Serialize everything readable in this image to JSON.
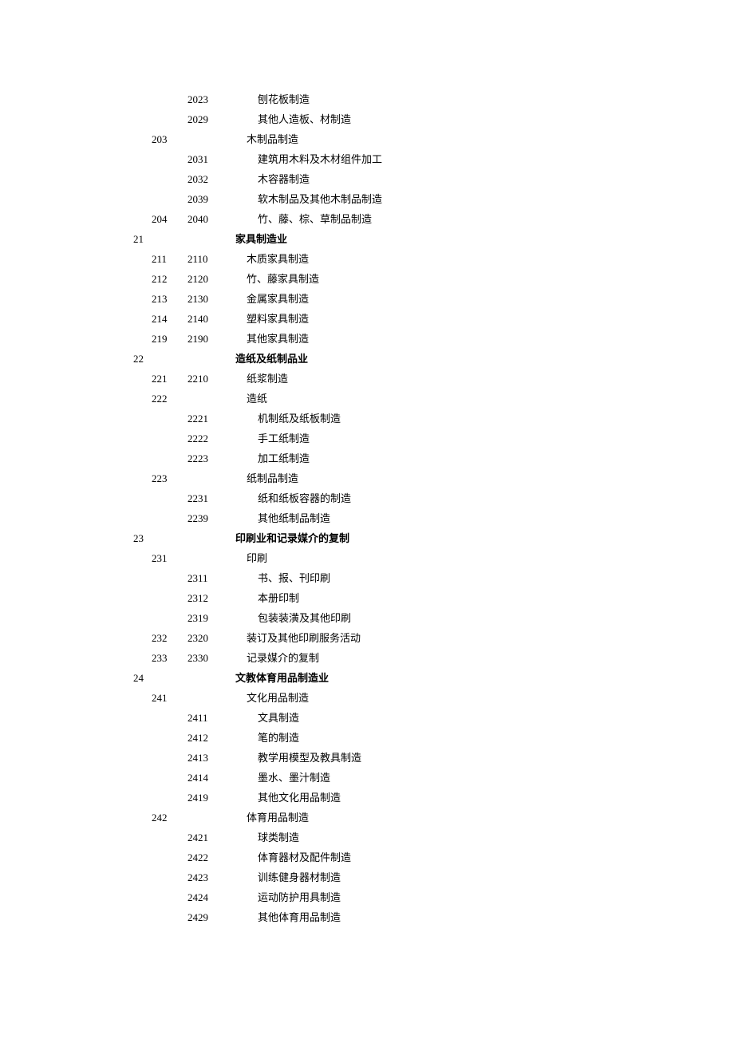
{
  "rows": [
    {
      "a": "",
      "b": "",
      "c": "2023",
      "d": "刨花板制造",
      "indent": 2,
      "bold": false
    },
    {
      "a": "",
      "b": "",
      "c": "2029",
      "d": "其他人造板、材制造",
      "indent": 2,
      "bold": false
    },
    {
      "a": "",
      "b": "203",
      "c": "",
      "d": "木制品制造",
      "indent": 1,
      "bold": false
    },
    {
      "a": "",
      "b": "",
      "c": "2031",
      "d": "建筑用木料及木材组件加工",
      "indent": 2,
      "bold": false
    },
    {
      "a": "",
      "b": "",
      "c": "2032",
      "d": "木容器制造",
      "indent": 2,
      "bold": false
    },
    {
      "a": "",
      "b": "",
      "c": "2039",
      "d": "软木制品及其他木制品制造",
      "indent": 2,
      "bold": false
    },
    {
      "a": "",
      "b": "204",
      "c": "2040",
      "d": "竹、藤、棕、草制品制造",
      "indent": 2,
      "bold": false
    },
    {
      "a": "21",
      "b": "",
      "c": "",
      "d": "家具制造业",
      "indent": 0,
      "bold": true
    },
    {
      "a": "",
      "b": "211",
      "c": "2110",
      "d": "木质家具制造",
      "indent": 1,
      "bold": false
    },
    {
      "a": "",
      "b": "212",
      "c": "2120",
      "d": "竹、藤家具制造",
      "indent": 1,
      "bold": false
    },
    {
      "a": "",
      "b": "213",
      "c": "2130",
      "d": "金属家具制造",
      "indent": 1,
      "bold": false
    },
    {
      "a": "",
      "b": "214",
      "c": "2140",
      "d": "塑料家具制造",
      "indent": 1,
      "bold": false
    },
    {
      "a": "",
      "b": "219",
      "c": "2190",
      "d": "其他家具制造",
      "indent": 1,
      "bold": false
    },
    {
      "a": "22",
      "b": "",
      "c": "",
      "d": "造纸及纸制品业",
      "indent": 0,
      "bold": true
    },
    {
      "a": "",
      "b": "221",
      "c": "2210",
      "d": "纸浆制造",
      "indent": 1,
      "bold": false
    },
    {
      "a": "",
      "b": "222",
      "c": "",
      "d": "造纸",
      "indent": 1,
      "bold": false
    },
    {
      "a": "",
      "b": "",
      "c": "2221",
      "d": "机制纸及纸板制造",
      "indent": 2,
      "bold": false
    },
    {
      "a": "",
      "b": "",
      "c": "2222",
      "d": "手工纸制造",
      "indent": 2,
      "bold": false
    },
    {
      "a": "",
      "b": "",
      "c": "2223",
      "d": "加工纸制造",
      "indent": 2,
      "bold": false
    },
    {
      "a": "",
      "b": "223",
      "c": "",
      "d": "纸制品制造",
      "indent": 1,
      "bold": false
    },
    {
      "a": "",
      "b": "",
      "c": "2231",
      "d": "纸和纸板容器的制造",
      "indent": 2,
      "bold": false
    },
    {
      "a": "",
      "b": "",
      "c": "2239",
      "d": "其他纸制品制造",
      "indent": 2,
      "bold": false
    },
    {
      "a": "23",
      "b": "",
      "c": "",
      "d": "印刷业和记录媒介的复制",
      "indent": 0,
      "bold": true
    },
    {
      "a": "",
      "b": "231",
      "c": "",
      "d": "印刷",
      "indent": 1,
      "bold": false
    },
    {
      "a": "",
      "b": "",
      "c": "2311",
      "d": "书、报、刊印刷",
      "indent": 2,
      "bold": false
    },
    {
      "a": "",
      "b": "",
      "c": "2312",
      "d": "本册印制",
      "indent": 2,
      "bold": false
    },
    {
      "a": "",
      "b": "",
      "c": "2319",
      "d": "包装装潢及其他印刷",
      "indent": 2,
      "bold": false
    },
    {
      "a": "",
      "b": "232",
      "c": "2320",
      "d": "装订及其他印刷服务活动",
      "indent": 1,
      "bold": false
    },
    {
      "a": "",
      "b": "233",
      "c": "2330",
      "d": "记录媒介的复制",
      "indent": 1,
      "bold": false
    },
    {
      "a": "24",
      "b": "",
      "c": "",
      "d": "文教体育用品制造业",
      "indent": 0,
      "bold": true
    },
    {
      "a": "",
      "b": "241",
      "c": "",
      "d": "文化用品制造",
      "indent": 1,
      "bold": false
    },
    {
      "a": "",
      "b": "",
      "c": "2411",
      "d": "文具制造",
      "indent": 2,
      "bold": false
    },
    {
      "a": "",
      "b": "",
      "c": "2412",
      "d": "笔的制造",
      "indent": 2,
      "bold": false
    },
    {
      "a": "",
      "b": "",
      "c": "2413",
      "d": "教学用模型及教具制造",
      "indent": 2,
      "bold": false
    },
    {
      "a": "",
      "b": "",
      "c": "2414",
      "d": "墨水、墨汁制造",
      "indent": 2,
      "bold": false
    },
    {
      "a": "",
      "b": "",
      "c": "2419",
      "d": "其他文化用品制造",
      "indent": 2,
      "bold": false
    },
    {
      "a": "",
      "b": "242",
      "c": "",
      "d": "体育用品制造",
      "indent": 1,
      "bold": false
    },
    {
      "a": "",
      "b": "",
      "c": "2421",
      "d": "球类制造",
      "indent": 2,
      "bold": false
    },
    {
      "a": "",
      "b": "",
      "c": "2422",
      "d": "体育器材及配件制造",
      "indent": 2,
      "bold": false
    },
    {
      "a": "",
      "b": "",
      "c": "2423",
      "d": "训练健身器材制造",
      "indent": 2,
      "bold": false
    },
    {
      "a": "",
      "b": "",
      "c": "2424",
      "d": "运动防护用具制造",
      "indent": 2,
      "bold": false
    },
    {
      "a": "",
      "b": "",
      "c": "2429",
      "d": "其他体育用品制造",
      "indent": 2,
      "bold": false
    }
  ]
}
